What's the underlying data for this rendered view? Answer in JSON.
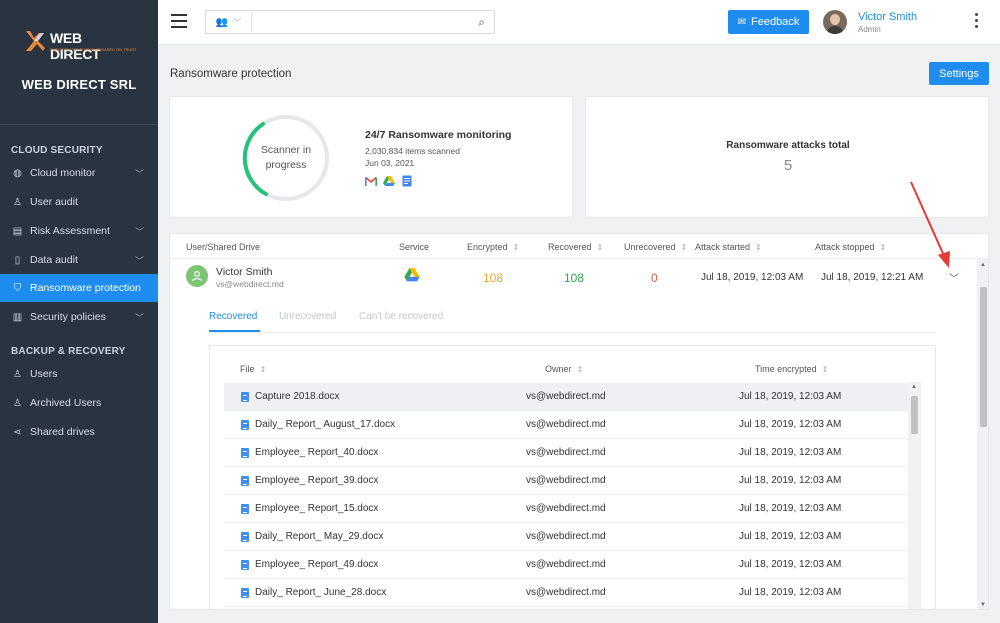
{
  "sidebar": {
    "logo": {
      "text": "WEB DIRECT",
      "tagline": "BUSINESS RELATIONSHIP BASED ON TRUST"
    },
    "company": "WEB DIRECT SRL",
    "sections": [
      {
        "title": "CLOUD SECURITY"
      },
      {
        "title": "BACKUP & RECOVERY"
      }
    ],
    "items": [
      {
        "label": "Cloud monitor",
        "icon": "globe-icon"
      },
      {
        "label": "User audit",
        "icon": "user-icon"
      },
      {
        "label": "Risk Assessment",
        "icon": "risk-icon"
      },
      {
        "label": "Data audit",
        "icon": "document-icon"
      },
      {
        "label": "Ransomware protection",
        "icon": "shield-icon",
        "active": true
      },
      {
        "label": "Security policies",
        "icon": "policy-icon"
      },
      {
        "label": "Users",
        "icon": "users-icon"
      },
      {
        "label": "Archived Users",
        "icon": "archived-users-icon"
      },
      {
        "label": "Shared drives",
        "icon": "share-icon"
      }
    ]
  },
  "topbar": {
    "feedback_label": "Feedback",
    "user_name": "Victor Smith",
    "user_role": "Admin"
  },
  "page": {
    "title": "Ransomware protection",
    "settings_label": "Settings"
  },
  "scanner": {
    "status_line1": "Scanner in",
    "status_line2": "progress",
    "title": "24/7 Ransomware monitoring",
    "scanned": "2,030,834 items scanned",
    "date": "Jun 03, 2021"
  },
  "attacks": {
    "title": "Ransomware attacks total",
    "count": "5"
  },
  "table": {
    "columns": [
      "User/Shared Drive",
      "Service",
      "Encrypted",
      "Recovered",
      "Unrecovered",
      "Attack started",
      "Attack stopped"
    ],
    "row": {
      "name": "Victor Smith",
      "email": "vs@webdirect.md",
      "encrypted": "108",
      "recovered": "108",
      "unrecovered": "0",
      "started": "Jul 18, 2019, 12:03 AM",
      "stopped": "Jul 18, 2019, 12:21 AM"
    }
  },
  "tabs": [
    "Recovered",
    "Unrecovered",
    "Can't be recovered"
  ],
  "files": {
    "columns": [
      "File",
      "Owner",
      "Time encrypted"
    ],
    "rows": [
      {
        "file": "Capture 2018.docx",
        "owner": "vs@webdirect.md",
        "time": "Jul 18, 2019, 12:03 AM"
      },
      {
        "file": "Daily_ Report_ August_17.docx",
        "owner": "vs@webdirect.md",
        "time": "Jul 18, 2019, 12:03 AM"
      },
      {
        "file": "Employee_ Report_40.docx",
        "owner": "vs@webdirect.md",
        "time": "Jul 18, 2019, 12:03 AM"
      },
      {
        "file": "Employee_ Report_39.docx",
        "owner": "vs@webdirect.md",
        "time": "Jul 18, 2019, 12:03 AM"
      },
      {
        "file": "Employee_ Report_15.docx",
        "owner": "vs@webdirect.md",
        "time": "Jul 18, 2019, 12:03 AM"
      },
      {
        "file": "Daily_ Report_ May_29.docx",
        "owner": "vs@webdirect.md",
        "time": "Jul 18, 2019, 12:03 AM"
      },
      {
        "file": "Employee_ Report_49.docx",
        "owner": "vs@webdirect.md",
        "time": "Jul 18, 2019, 12:03 AM"
      },
      {
        "file": "Daily_ Report_ June_28.docx",
        "owner": "vs@webdirect.md",
        "time": "Jul 18, 2019, 12:03 AM"
      }
    ]
  },
  "colors": {
    "accent": "#1f8df0",
    "sidebar_bg": "#2a3441",
    "encrypted": "#f0a23a",
    "recovered": "#2fa84f",
    "unrecovered": "#e85d3b",
    "annotation_arrow": "#e53935"
  }
}
